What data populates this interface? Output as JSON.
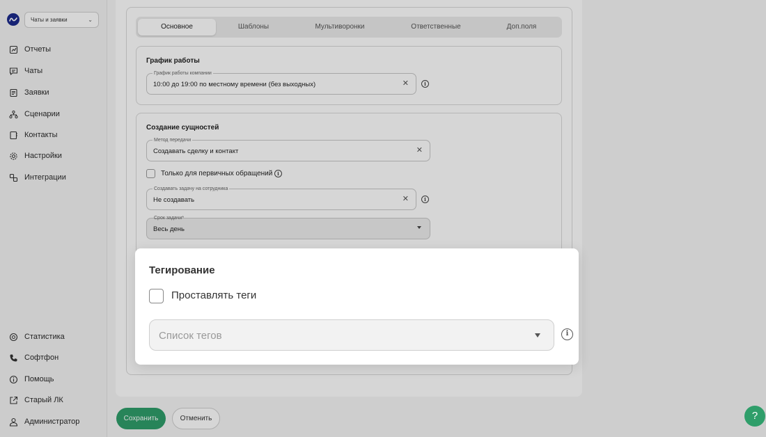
{
  "sidebar": {
    "workspace": "Чаты и заявки",
    "items": [
      {
        "label": "Отчеты",
        "icon": "reports-icon"
      },
      {
        "label": "Чаты",
        "icon": "chat-icon"
      },
      {
        "label": "Заявки",
        "icon": "requests-icon"
      },
      {
        "label": "Сценарии",
        "icon": "scenarios-icon"
      },
      {
        "label": "Контакты",
        "icon": "contacts-icon"
      },
      {
        "label": "Настройки",
        "icon": "gear-icon"
      },
      {
        "label": "Интеграции",
        "icon": "integrations-icon"
      }
    ],
    "bottom_items": [
      {
        "label": "Статистика",
        "icon": "statistics-icon"
      },
      {
        "label": "Софтфон",
        "icon": "phone-icon"
      },
      {
        "label": "Помощь",
        "icon": "help-circle-icon"
      },
      {
        "label": "Старый ЛК",
        "icon": "external-link-icon"
      },
      {
        "label": "Администратор",
        "icon": "user-icon"
      }
    ]
  },
  "tabs": [
    {
      "label": "Основное",
      "active": true
    },
    {
      "label": "Шаблоны",
      "active": false
    },
    {
      "label": "Мультиворонки",
      "active": false
    },
    {
      "label": "Ответственные",
      "active": false
    },
    {
      "label": "Доп.поля",
      "active": false
    }
  ],
  "schedule": {
    "title": "График работы",
    "field_label": "График работы компании",
    "field_value": "10:00 до 19:00 по местному времени (без выходных)"
  },
  "entities": {
    "title": "Создание сущностей",
    "method_label": "Метод передачи",
    "method_value": "Создавать сделку и контакт",
    "primary_only_label": "Только для первичных обращений",
    "task_label": "Создавать задачу на сотрудника",
    "task_value": "Не создавать",
    "deadline_label": "Срок задачи*",
    "deadline_value": "Весь день"
  },
  "tagging_popup": {
    "title": "Тегирование",
    "checkbox_label": "Проставлять теги",
    "select_placeholder": "Список тегов"
  },
  "actions": {
    "save": "Сохранить",
    "cancel": "Отменить"
  },
  "help_button": "?",
  "colors": {
    "accent": "#2f9e6a",
    "logo": "#1c2a8c"
  }
}
